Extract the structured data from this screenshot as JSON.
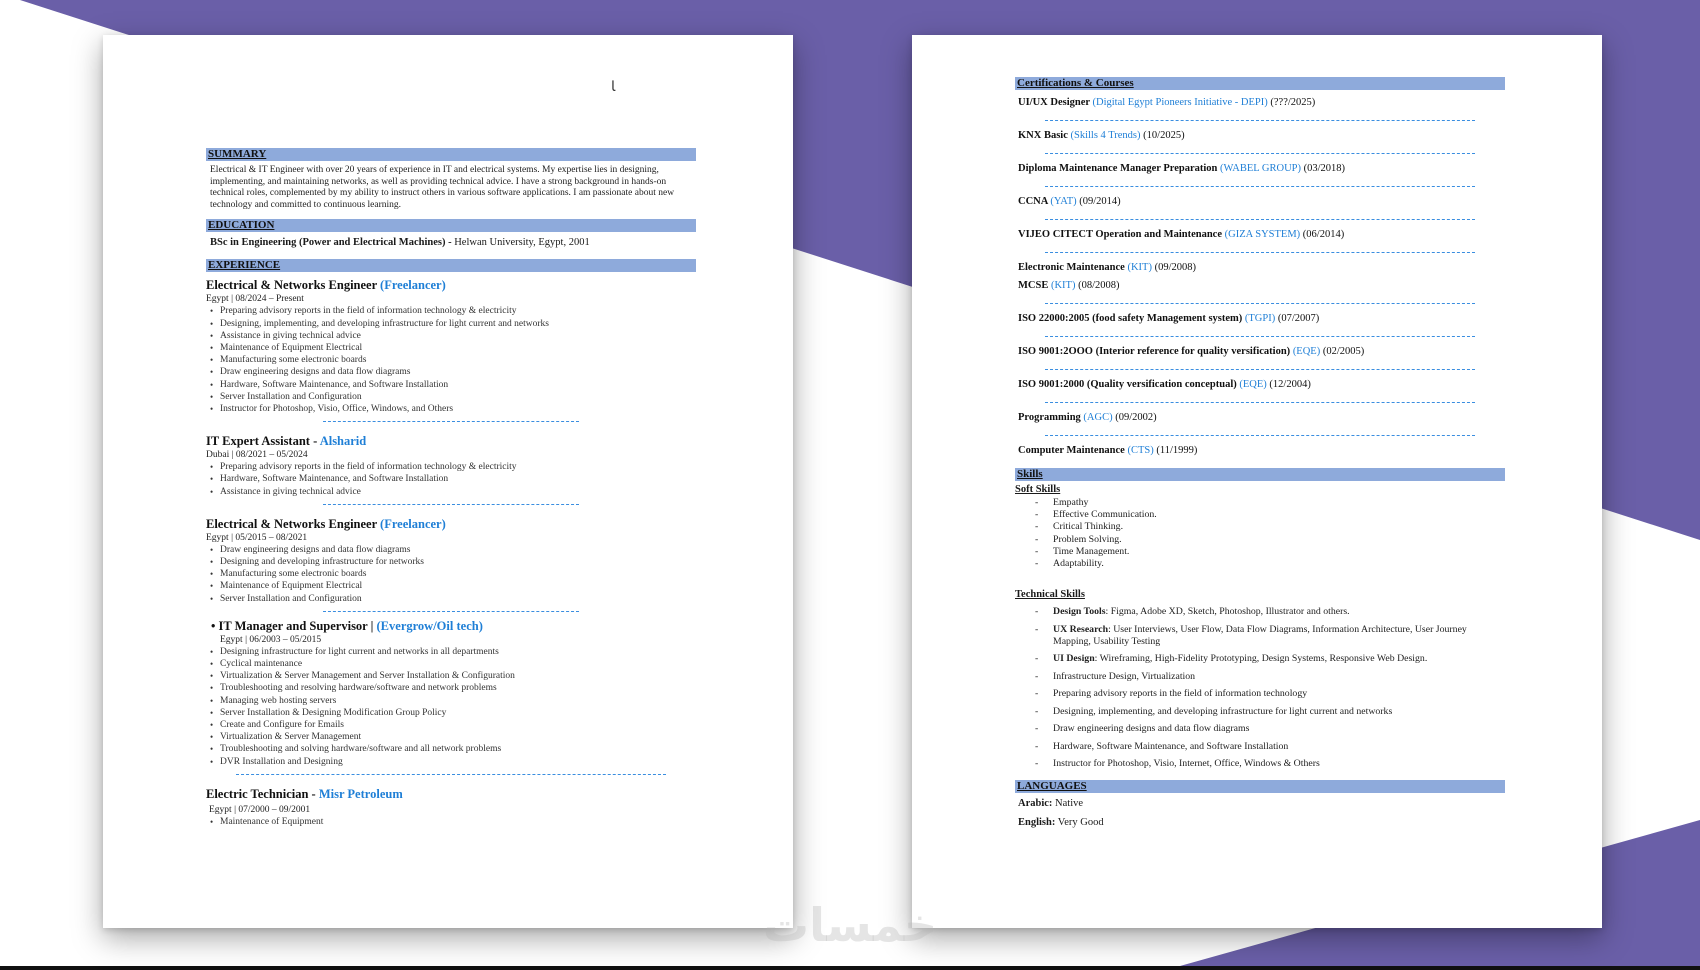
{
  "colors": {
    "purple": "#6a5fa8",
    "accent_blue": "#1f7fd6",
    "section_bar": "#8eaadb"
  },
  "left_page": {
    "scribble_mark": "ﺎ",
    "summary": {
      "heading": "SUMMARY",
      "text": "Electrical & IT Engineer with over 20 years of experience in IT and electrical systems. My expertise lies in designing, implementing, and maintaining networks, as well as providing technical advice. I have a strong background in hands-on technical roles, complemented by my ability to instruct others in various software applications. I am passionate about new technology and committed to continuous learning."
    },
    "education": {
      "heading": "EDUCATION",
      "degree": "BSc in Engineering (Power and Electrical Machines) -",
      "school": " Helwan University, Egypt, 2001"
    },
    "experience": {
      "heading": "EXPERIENCE",
      "jobs": [
        {
          "title": "Electrical & Networks Engineer ",
          "company": "(Freelancer)",
          "meta": "Egypt | 08/2024 – Present",
          "bullets": [
            "Preparing advisory reports in the field of information technology & electricity",
            "Designing, implementing, and developing infrastructure for light current and networks",
            "Assistance in giving technical advice",
            "Maintenance of Equipment Electrical",
            "Manufacturing some electronic boards",
            "Draw engineering designs and data flow diagrams",
            "Hardware, Software Maintenance, and Software Installation",
            "Server Installation and Configuration",
            "Instructor for Photoshop, Visio, Office, Windows, and Others"
          ]
        },
        {
          "title": "IT Expert Assistant - ",
          "company": "Alsharid",
          "meta": "Dubai | 08/2021 – 05/2024",
          "bullets": [
            "Preparing advisory reports in the field of information technology & electricity",
            "Hardware, Software Maintenance, and Software Installation",
            "Assistance in giving technical advice"
          ]
        },
        {
          "title": "Electrical & Networks Engineer ",
          "company": "(Freelancer)",
          "meta": "Egypt | 05/2015 – 08/2021",
          "bullets": [
            "Draw engineering designs and data flow diagrams",
            "Designing and developing infrastructure for networks",
            "Manufacturing some electronic boards",
            "Maintenance of Equipment Electrical",
            "Server Installation and Configuration"
          ]
        },
        {
          "title": "IT Manager and Supervisor | ",
          "company": "(Evergrow/Oil tech)",
          "meta": "Egypt | 06/2003 – 05/2015",
          "bullets": [
            "Designing infrastructure for light current and networks in all departments",
            "Cyclical maintenance",
            "Virtualization & Server Management and Server Installation & Configuration",
            "Troubleshooting and resolving hardware/software and network problems",
            "Managing web hosting servers",
            "Server Installation & Designing Modification Group Policy",
            "Create and Configure for Emails",
            "Virtualization & Server Management",
            "Troubleshooting and solving hardware/software and all network problems",
            "DVR Installation and Designing"
          ]
        },
        {
          "title": "Electric Technician - ",
          "company": "Misr Petroleum",
          "meta": "Egypt | 07/2000 – 09/2001",
          "bullets": [
            "Maintenance of Equipment"
          ]
        }
      ]
    }
  },
  "right_page": {
    "certifications": {
      "heading": "Certifications & Courses",
      "items": [
        {
          "name": "UI/UX Designer ",
          "org": "(Digital Egypt Pioneers Initiative - DEPI)",
          "date": " (???/2025)"
        },
        {
          "name": "KNX Basic ",
          "org": "(Skills 4 Trends)",
          "date": " (10/2025)"
        },
        {
          "name": "Diploma Maintenance Manager Preparation ",
          "org": "(WABEL GROUP)",
          "date": " (03/2018)"
        },
        {
          "name": "CCNA ",
          "org": "(YAT)",
          "date": " (09/2014)"
        },
        {
          "name": "VIJEO CITECT Operation and Maintenance ",
          "org": "(GIZA SYSTEM)",
          "date": " (06/2014)"
        },
        {
          "name": "Electronic Maintenance ",
          "org": "(KIT)",
          "date": " (09/2008)"
        },
        {
          "name": "MCSE ",
          "org": "(KIT)",
          "date": " (08/2008)"
        },
        {
          "name": "ISO 22000:2005 (food safety Management system) ",
          "org": "(TGPI)",
          "date": " (07/2007)"
        },
        {
          "name": "ISO 9001:2OOO (Interior reference for quality versification) ",
          "org": "(EQE)",
          "date": " (02/2005)"
        },
        {
          "name": "ISO 9001:2000 (Quality versification conceptual) ",
          "org": "(EQE)",
          "date": " (12/2004)"
        },
        {
          "name": "Programming ",
          "org": "(AGC)",
          "date": " (09/2002)"
        },
        {
          "name": "Computer Maintenance ",
          "org": "(CTS)",
          "date": " (11/1999)"
        }
      ]
    },
    "skills": {
      "heading": "Skills",
      "soft_heading": "Soft Skills",
      "soft": [
        "Empathy",
        "Effective Communication.",
        "Critical Thinking.",
        "Problem Solving.",
        "Time Management.",
        "Adaptability."
      ],
      "tech_heading": "Technical Skills",
      "tech": [
        {
          "label": "Design Tools",
          "text": ": Figma, Adobe XD, Sketch, Photoshop, Illustrator and others."
        },
        {
          "label": "UX Research",
          "text": ": User Interviews, User Flow, Data Flow Diagrams, Information Architecture, User Journey Mapping, Usability Testing"
        },
        {
          "label": "UI Design",
          "text": ": Wireframing, High-Fidelity Prototyping, Design Systems, Responsive Web Design."
        },
        {
          "label": "",
          "text": "Infrastructure Design, Virtualization"
        },
        {
          "label": "",
          "text": "Preparing advisory reports in the field of information technology"
        },
        {
          "label": "",
          "text": "Designing, implementing, and developing infrastructure for light current and networks"
        },
        {
          "label": "",
          "text": "Draw engineering designs and data flow diagrams"
        },
        {
          "label": "",
          "text": "Hardware, Software Maintenance, and Software Installation"
        },
        {
          "label": "",
          "text": "Instructor for Photoshop, Visio, Internet, Office, Windows & Others"
        }
      ]
    },
    "languages": {
      "heading": "LANGUAGES",
      "items": [
        {
          "label": "Arabic:",
          "value": " Native"
        },
        {
          "label": "English:",
          "value": " Very Good"
        }
      ]
    }
  },
  "watermark": {
    "text": "خمسات"
  }
}
